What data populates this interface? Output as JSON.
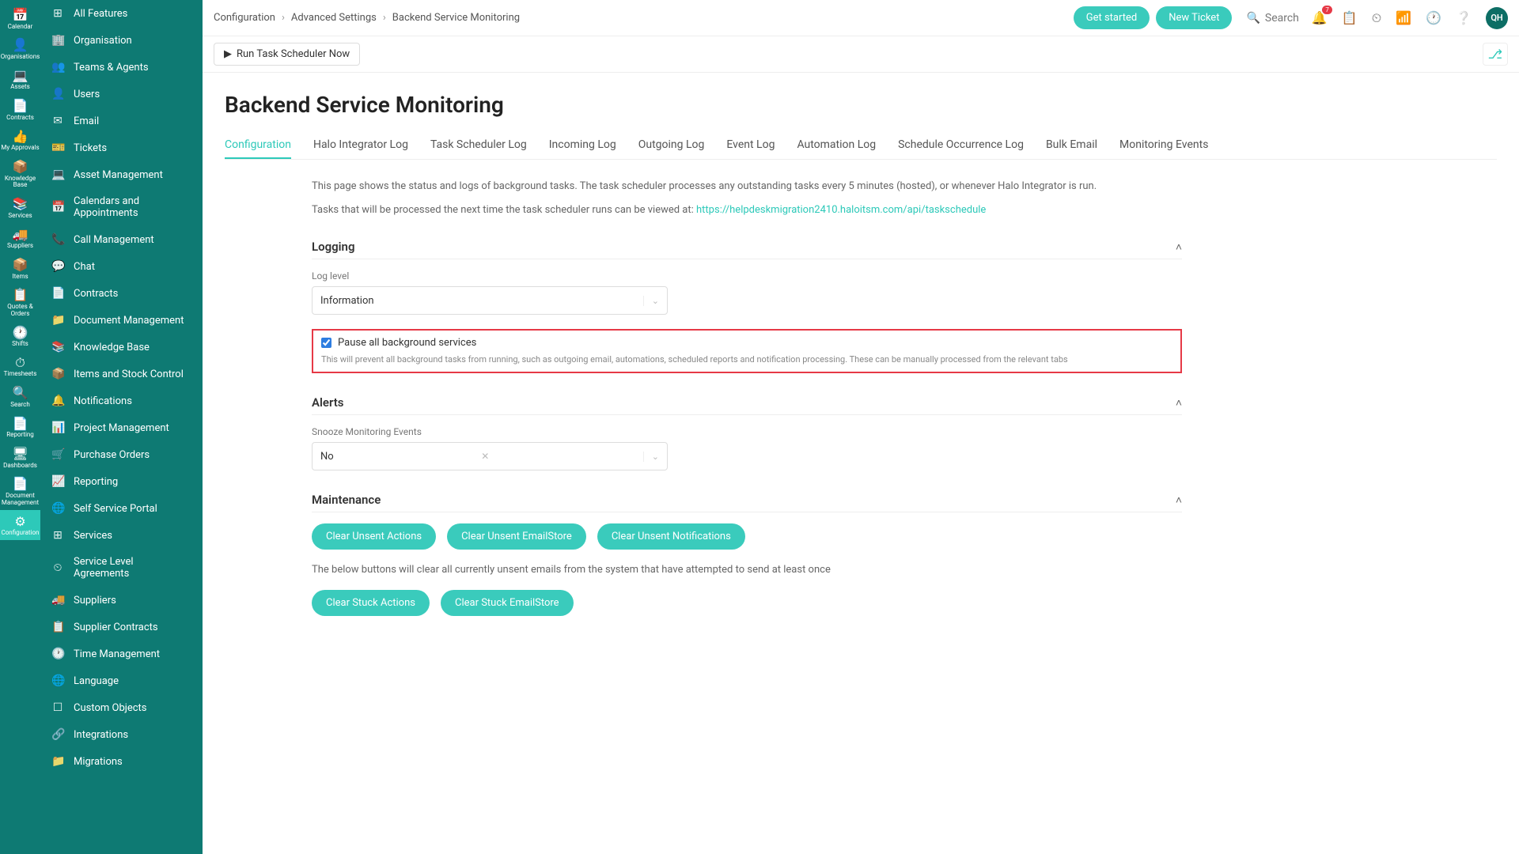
{
  "iconSidebar": [
    {
      "icon": "📅",
      "label": "Calendar"
    },
    {
      "icon": "👤",
      "label": "Organisations"
    },
    {
      "icon": "💻",
      "label": "Assets"
    },
    {
      "icon": "📄",
      "label": "Contracts"
    },
    {
      "icon": "👍",
      "label": "My Approvals"
    },
    {
      "icon": "📦",
      "label": "Knowledge Base"
    },
    {
      "icon": "📚",
      "label": "Services"
    },
    {
      "icon": "🚚",
      "label": "Suppliers"
    },
    {
      "icon": "📦",
      "label": "Items"
    },
    {
      "icon": "📋",
      "label": "Quotes & Orders"
    },
    {
      "icon": "🕐",
      "label": "Shifts"
    },
    {
      "icon": "⏱",
      "label": "Timesheets"
    },
    {
      "icon": "🔍",
      "label": "Search"
    },
    {
      "icon": "📄",
      "label": "Reporting"
    },
    {
      "icon": "🖥",
      "label": "Dashboards"
    },
    {
      "icon": "📄",
      "label": "Document Management"
    },
    {
      "icon": "⚙",
      "label": "Configuration",
      "active": true
    }
  ],
  "menuSidebar": [
    {
      "icon": "⊞",
      "label": "All Features"
    },
    {
      "icon": "🏢",
      "label": "Organisation"
    },
    {
      "icon": "👥",
      "label": "Teams & Agents"
    },
    {
      "icon": "👤",
      "label": "Users"
    },
    {
      "icon": "✉",
      "label": "Email"
    },
    {
      "icon": "🎫",
      "label": "Tickets"
    },
    {
      "icon": "💻",
      "label": "Asset Management"
    },
    {
      "icon": "📅",
      "label": "Calendars and Appointments"
    },
    {
      "icon": "📞",
      "label": "Call Management"
    },
    {
      "icon": "💬",
      "label": "Chat"
    },
    {
      "icon": "📄",
      "label": "Contracts"
    },
    {
      "icon": "📁",
      "label": "Document Management"
    },
    {
      "icon": "📚",
      "label": "Knowledge Base"
    },
    {
      "icon": "📦",
      "label": "Items and Stock Control"
    },
    {
      "icon": "🔔",
      "label": "Notifications"
    },
    {
      "icon": "📊",
      "label": "Project Management"
    },
    {
      "icon": "🛒",
      "label": "Purchase Orders"
    },
    {
      "icon": "📈",
      "label": "Reporting"
    },
    {
      "icon": "🌐",
      "label": "Self Service Portal"
    },
    {
      "icon": "⊞",
      "label": "Services"
    },
    {
      "icon": "⏲",
      "label": "Service Level Agreements"
    },
    {
      "icon": "🚚",
      "label": "Suppliers"
    },
    {
      "icon": "📋",
      "label": "Supplier Contracts"
    },
    {
      "icon": "🕐",
      "label": "Time Management"
    },
    {
      "icon": "🌐",
      "label": "Language"
    },
    {
      "icon": "☐",
      "label": "Custom Objects"
    },
    {
      "icon": "🔗",
      "label": "Integrations"
    },
    {
      "icon": "📁",
      "label": "Migrations"
    }
  ],
  "breadcrumb": [
    "Configuration",
    "Advanced Settings",
    "Backend Service Monitoring"
  ],
  "topbar": {
    "getStarted": "Get started",
    "newTicket": "New Ticket",
    "search": "Search",
    "badge": "7",
    "avatar": "QH"
  },
  "runButton": "Run Task Scheduler Now",
  "page": {
    "title": "Backend Service Monitoring",
    "tabs": [
      "Configuration",
      "Halo Integrator Log",
      "Task Scheduler Log",
      "Incoming Log",
      "Outgoing Log",
      "Event Log",
      "Automation Log",
      "Schedule Occurrence Log",
      "Bulk Email",
      "Monitoring Events"
    ],
    "desc1": "This page shows the status and logs of background tasks. The task scheduler processes any outstanding tasks every 5 minutes (hosted), or whenever Halo Integrator is run.",
    "desc2a": "Tasks that will be processed the next time the task scheduler runs can be viewed at: ",
    "desc2link": "https://helpdeskmigration2410.haloitsm.com/api/taskschedule",
    "logging": {
      "title": "Logging",
      "logLevelLabel": "Log level",
      "logLevelValue": "Information",
      "pauseLabel": "Pause all background services",
      "pauseHelp": "This will prevent all background tasks from running, such as outgoing email, automations, scheduled reports and notification processing. These can be manually processed from the relevant tabs"
    },
    "alerts": {
      "title": "Alerts",
      "snoozeLabel": "Snooze Monitoring Events",
      "snoozeValue": "No"
    },
    "maintenance": {
      "title": "Maintenance",
      "buttons1": [
        "Clear Unsent Actions",
        "Clear Unsent EmailStore",
        "Clear Unsent Notifications"
      ],
      "note": "The below buttons will clear all currently unsent emails from the system that have attempted to send at least once",
      "buttons2": [
        "Clear Stuck Actions",
        "Clear Stuck EmailStore"
      ]
    }
  }
}
